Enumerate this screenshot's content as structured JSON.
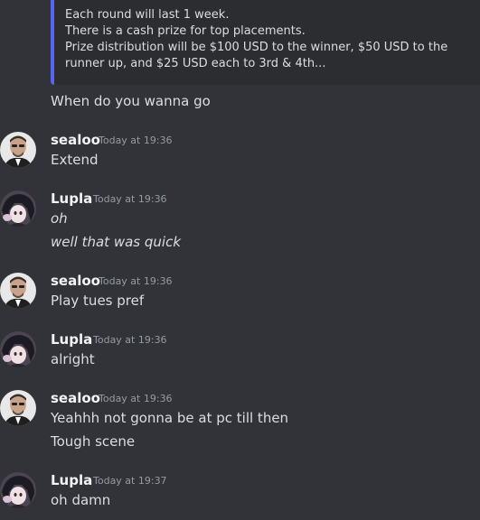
{
  "embed": {
    "lines": [
      "Each round will last 1 week.",
      "There is a cash prize for top placements.",
      "Prize distribution will be $100 USD to the winner, $50 USD to the",
      "runner up, and $25 USD each to 3rd & 4th..."
    ]
  },
  "continuation": "When do you wanna go",
  "messages": [
    {
      "author": "sealoo",
      "time": "Today at 19:36",
      "lines": [
        "Extend"
      ]
    },
    {
      "author": "Lupla",
      "time": "Today at 19:36",
      "lines": [
        "oh",
        "well that was quick"
      ]
    },
    {
      "author": "sealoo",
      "time": "Today at 19:36",
      "lines": [
        "Play tues pref"
      ]
    },
    {
      "author": "Lupla",
      "time": "Today at 19:36",
      "lines": [
        "alright"
      ]
    },
    {
      "author": "sealoo",
      "time": "Today at 19:36",
      "lines": [
        "Yeahhh not gonna be at pc till then",
        "Tough scene"
      ]
    },
    {
      "author": "Lupla",
      "time": "Today at 19:37",
      "lines": [
        "oh damn"
      ]
    }
  ],
  "colors": {
    "background": "#313338",
    "embed_background": "#2b2d31",
    "embed_border": "#5865f2",
    "text": "#dbdee1",
    "username": "#f2f3f5",
    "timestamp": "#949ba4"
  },
  "icons": [
    "avatar-sealoo",
    "avatar-lupla"
  ]
}
